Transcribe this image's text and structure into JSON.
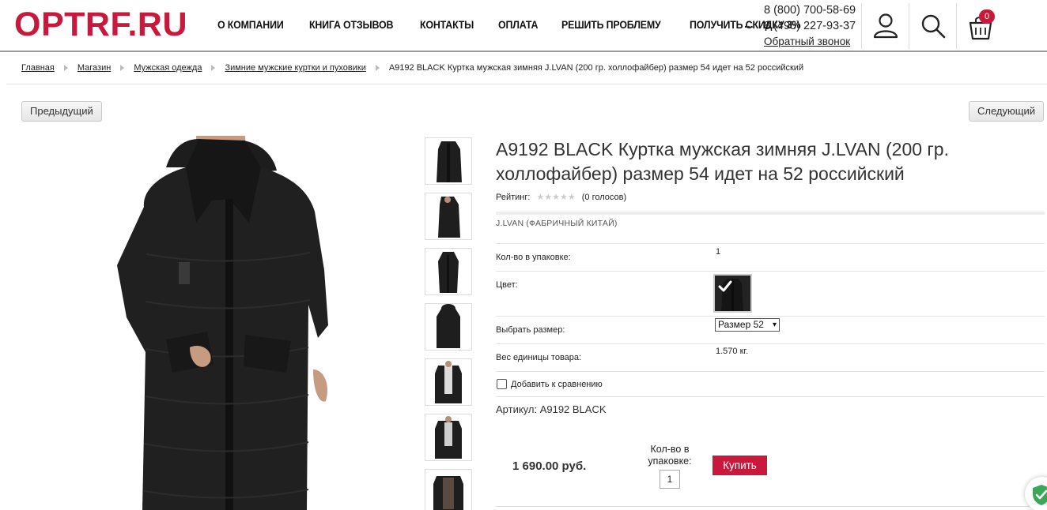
{
  "header": {
    "logo": "OPTRF.RU",
    "nav": [
      "О КОМПАНИИ",
      "КНИГА ОТЗЫВОВ",
      "КОНТАКТЫ",
      "ОПЛАТА",
      "РЕШИТЬ ПРОБЛЕМУ",
      "ПОЛУЧИТЬ СКИДКУ 3%"
    ],
    "nav_more": "...",
    "phone1": "8 (800) 700-58-69",
    "phone2": "8 (495) 227-93-37",
    "callback": "Обратный звонок",
    "cart_count": "0",
    "brand_color": "#c8193c"
  },
  "breadcrumbs": [
    "Главная",
    "Магазин",
    "Мужская одежда",
    "Зимние мужские куртки и пуховики"
  ],
  "breadcrumb_current": "A9192 BLACK Куртка мужская зимняя J.LVAN (200 гр. холлофайбер) размер 54 идет на 52 российский",
  "pager": {
    "prev": "Предыдущий",
    "next": "Следующий"
  },
  "product": {
    "title": "A9192 BLACK Куртка мужская зимняя J.LVAN (200 гр. холлофайбер) размер 54 идет на 52 российский",
    "rating_label": "Рейтинг:",
    "stars": "★★★★★",
    "votes": "(0 голосов)",
    "brand": "J.LVAN (ФАБРИЧНЫЙ КИТАЙ)",
    "pack_label": "Кол-во в упаковке:",
    "pack_value": "1",
    "color_label": "Цвет:",
    "size_label": "Выбрать размер:",
    "size_value": "Размер 52",
    "weight_label": "Вес единицы товара:",
    "weight_value": "1.570 кг.",
    "compare": "Добавить к сравнению",
    "sku": "Артикул: A9192 BLACK",
    "price": "1 690.00 руб.",
    "qty_label": "Кол-во в упаковке:",
    "qty_value": "1",
    "buy": "Купить"
  }
}
